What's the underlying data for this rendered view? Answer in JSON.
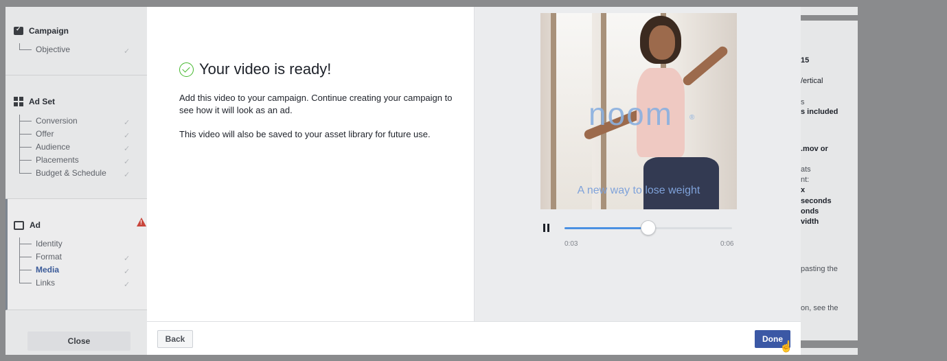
{
  "sidebar": {
    "campaign": {
      "title": "Campaign",
      "items": [
        {
          "label": "Objective",
          "done": true
        }
      ]
    },
    "adset": {
      "title": "Ad Set",
      "items": [
        {
          "label": "Conversion",
          "done": true
        },
        {
          "label": "Offer",
          "done": true
        },
        {
          "label": "Audience",
          "done": true
        },
        {
          "label": "Placements",
          "done": true
        },
        {
          "label": "Budget & Schedule",
          "done": true
        }
      ]
    },
    "ad": {
      "title": "Ad",
      "status": "warning",
      "items": [
        {
          "label": "Identity",
          "done": false
        },
        {
          "label": "Format",
          "done": true
        },
        {
          "label": "Media",
          "done": true,
          "active": true
        },
        {
          "label": "Links",
          "done": true
        }
      ]
    },
    "close_label": "Close"
  },
  "background_panel": {
    "lines": [
      "15",
      "/ertical",
      "s",
      "s included",
      ".mov or",
      "ats",
      "nt:",
      "x",
      "seconds",
      "onds",
      "vidth",
      "pasting the",
      "on, see the"
    ]
  },
  "modal": {
    "heading": "Your video is ready!",
    "paragraph1": "Add this video to your campaign. Continue creating your campaign to see how it will look as an ad.",
    "paragraph2": "This video will also be saved to your asset library for future use.",
    "video": {
      "brand_text": "noom",
      "brand_mark": "®",
      "caption": "A new way to lose weight",
      "current_time": "0:03",
      "duration": "0:06",
      "progress_fraction": 0.5,
      "state": "playing"
    },
    "footer": {
      "back_label": "Back",
      "done_label": "Done"
    }
  },
  "colors": {
    "accent": "#3b58a5",
    "success": "#42b72a",
    "warning": "#c8453b",
    "progress": "#4a90e2"
  }
}
